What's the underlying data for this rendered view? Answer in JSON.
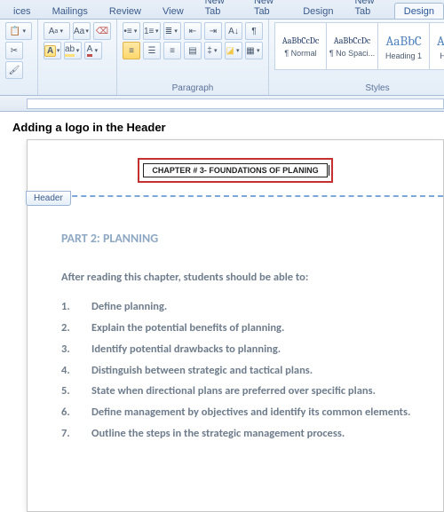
{
  "tabs": [
    "ices",
    "Mailings",
    "Review",
    "View",
    "New Tab",
    "New Tab",
    "Design",
    "New Tab",
    "Design"
  ],
  "active_tab_index": 8,
  "ribbon": {
    "paragraph_label": "Paragraph",
    "styles_label": "Styles",
    "styles": [
      {
        "preview": "AaBbCcDc",
        "name": "¶ Normal",
        "cls": "sz10"
      },
      {
        "preview": "AaBbCcDc",
        "name": "¶ No Spaci...",
        "cls": "sz10"
      },
      {
        "preview": "AaBbC",
        "name": "Heading 1",
        "cls": "sz14"
      },
      {
        "preview": "AaBbC",
        "name": "Heading",
        "cls": "sz14"
      }
    ]
  },
  "title": "Adding a logo in the Header",
  "header_label": "Header",
  "header_text": "CHAPTER # 3- FOUNDATIONS OF PLANING",
  "doc": {
    "part": "PART 2: PLANNING",
    "intro": "After reading this chapter, students should be able to:",
    "items": [
      "Define planning.",
      "Explain the potential benefits of planning.",
      "Identify potential drawbacks to planning.",
      "Distinguish between strategic and tactical plans.",
      "State when directional plans are preferred over specific plans.",
      "Define management by objectives and identify its common elements.",
      "Outline the steps in the strategic management process."
    ]
  }
}
